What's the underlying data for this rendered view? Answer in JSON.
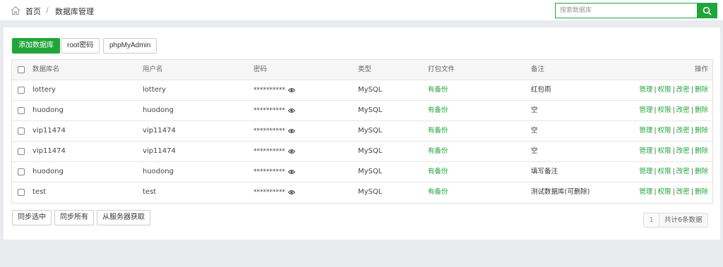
{
  "breadcrumb": {
    "home": "首页",
    "separator": "/",
    "current": "数据库管理"
  },
  "search": {
    "placeholder": "搜索数据库",
    "value": ""
  },
  "toolbar": {
    "add_label": "添加数据库",
    "root_label": "root密码",
    "phpmyadmin_label": "phpMyAdmin"
  },
  "table": {
    "headers": {
      "name": "数据库名",
      "user": "用户名",
      "password": "密码",
      "type": "类型",
      "package": "打包文件",
      "note": "备注",
      "ops": "操作"
    },
    "rows": [
      {
        "name": "lottery",
        "user": "lottery",
        "password": "**********",
        "type": "MySQL",
        "package": "有备份",
        "note": "红包雨"
      },
      {
        "name": "huodong",
        "user": "huodong",
        "password": "**********",
        "type": "MySQL",
        "package": "有备份",
        "note": "空"
      },
      {
        "name": "vip11474",
        "user": "vip11474",
        "password": "**********",
        "type": "MySQL",
        "package": "有备份",
        "note": "空"
      },
      {
        "name": "vip11474",
        "user": "vip11474",
        "password": "**********",
        "type": "MySQL",
        "package": "有备份",
        "note": "空"
      },
      {
        "name": "huodong",
        "user": "huodong",
        "password": "**********",
        "type": "MySQL",
        "package": "有备份",
        "note": "填写备注"
      },
      {
        "name": "test",
        "user": "test",
        "password": "**********",
        "type": "MySQL",
        "package": "有备份",
        "note": "测试数据库(可删除)"
      }
    ],
    "ops": {
      "manage": "管理",
      "perm": "权限",
      "chpass": "改密",
      "delete": "删除",
      "sep": "|"
    }
  },
  "bottom": {
    "sync_selected": "同步选中",
    "sync_all": "同步所有",
    "fetch_server": "从服务器获取"
  },
  "pagination": {
    "current_page": "1",
    "total_text": "共计6条数据"
  },
  "colors": {
    "accent": "#20a53a",
    "background": "#e9ebee"
  },
  "icons": {
    "home": "home-icon",
    "search": "search-icon",
    "eye": "eye-icon"
  }
}
